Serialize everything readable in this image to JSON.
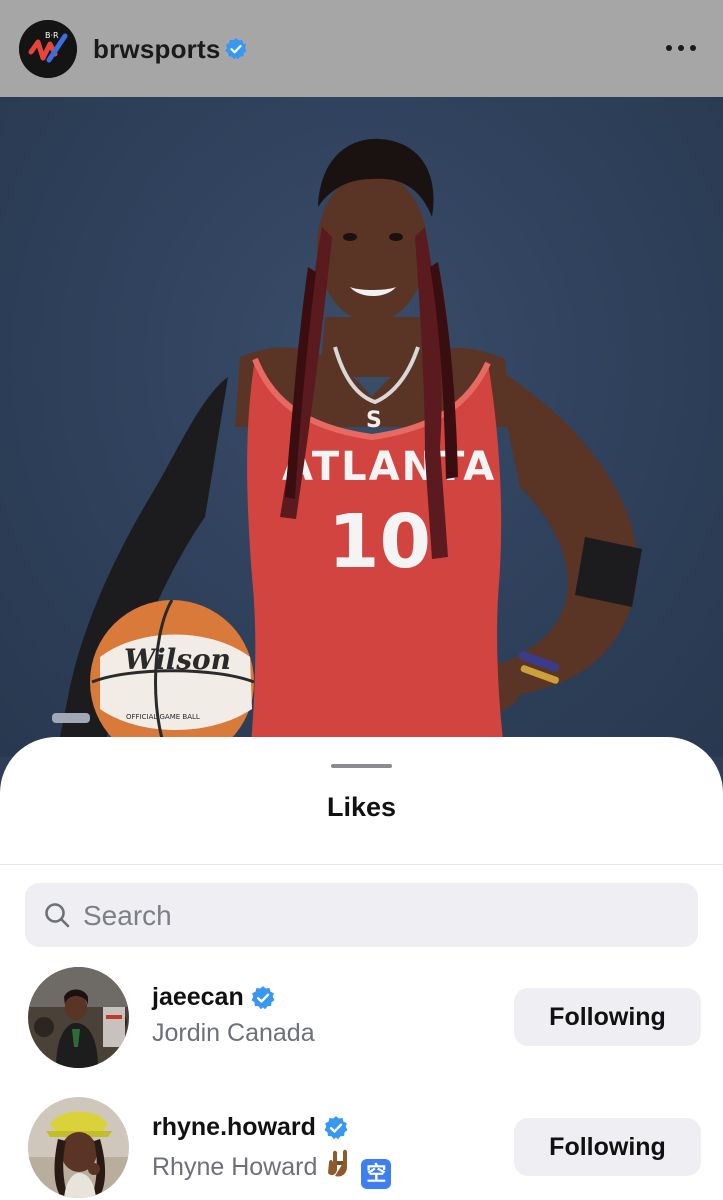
{
  "post": {
    "username": "brwsports",
    "verified": true,
    "brand_logo_text": "B·R",
    "photo": {
      "jersey_text": "ATLANTA",
      "jersey_number": "10",
      "ball_brand": "Wilson",
      "ball_small_text": "OFFICIAL GAME BALL"
    }
  },
  "likes_sheet": {
    "title": "Likes",
    "search": {
      "placeholder": "Search"
    },
    "users": [
      {
        "username": "jaeecan",
        "full_name": "Jordin Canada",
        "verified": true,
        "button_label": "Following"
      },
      {
        "username": "rhyne.howard",
        "full_name": "Rhyne Howard",
        "verified": true,
        "emoji_suffix": [
          "sign-of-horns-emoji",
          "sky-kanji-emoji"
        ],
        "emoji_sky_char": "空",
        "button_label": "Following"
      }
    ]
  },
  "colors": {
    "header_bg": "#a6a6a6",
    "photo_bg": "#30425d",
    "verified_blue": "#3897f0",
    "button_bg": "#efeff3",
    "secondary_text": "#6d7077"
  }
}
